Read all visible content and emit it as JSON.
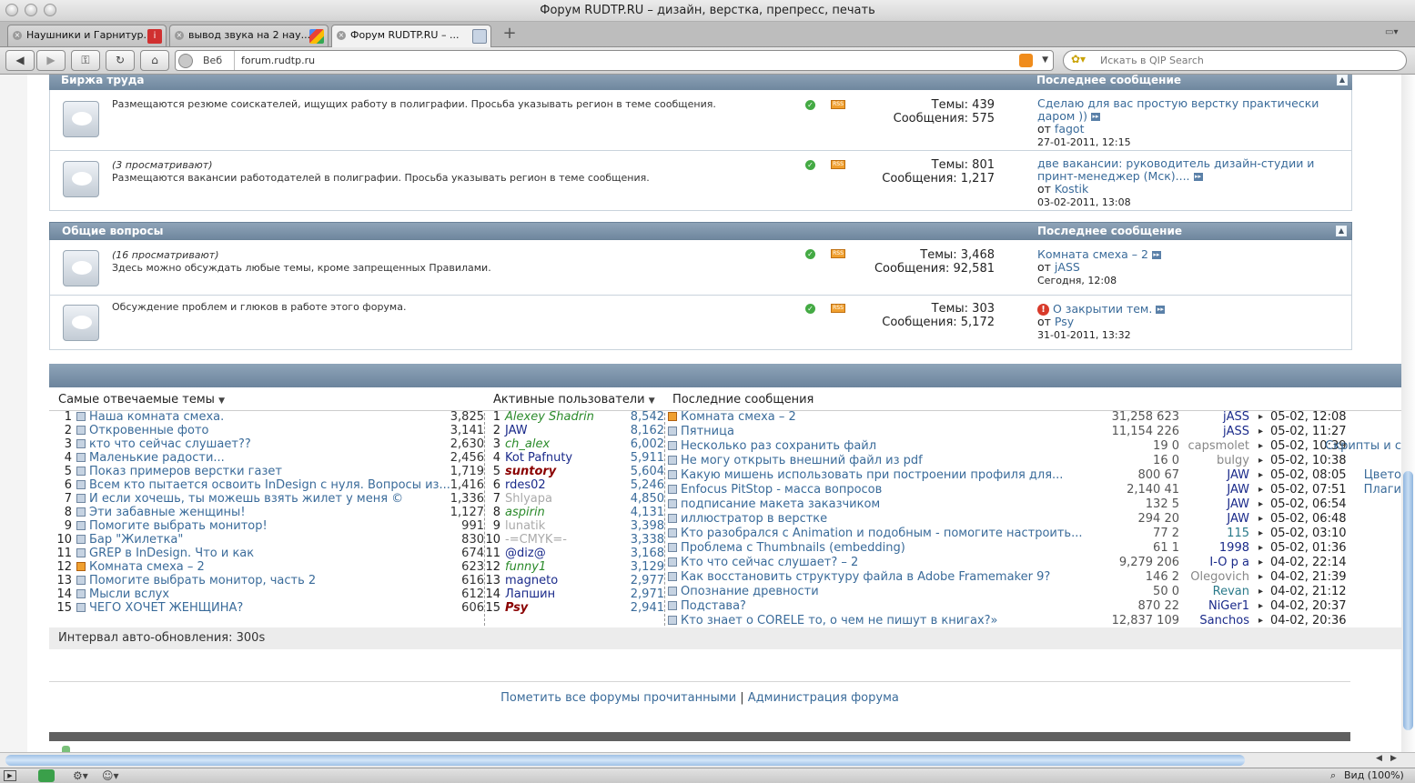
{
  "window": {
    "title": "Форум RUDTP.RU – дизайн, верстка, препресс, печать"
  },
  "tabs": [
    {
      "label": "Наушники и Гарнитур..."
    },
    {
      "label": "вывод звука на 2 нау..."
    },
    {
      "label": "Форум RUDTP.RU – ..."
    }
  ],
  "toolbar": {
    "web_label": "Веб",
    "url": "forum.rudtp.ru",
    "search_placeholder": "Искать в QIP Search"
  },
  "sections": [
    {
      "title": "Биржа труда",
      "last_label": "Последнее сообщение",
      "forums": [
        {
          "viewers": "",
          "desc": "Размещаются резюме соискателей, ищущих работу в полиграфии. Просьба указывать регион в теме сообщения.",
          "topics": "Темы: 439",
          "posts": "Сообщения: 575",
          "last_title": "Сделаю для вас простую верстку практически даром ))",
          "last_by_prefix": "от",
          "last_by": "fagot",
          "last_date": "27-01-2011, 12:15"
        },
        {
          "viewers": "(3 просматривают)",
          "desc": "Размещаются вакансии работодателей в полиграфии. Просьба указывать регион в теме сообщения.",
          "topics": "Темы: 801",
          "posts": "Сообщения: 1,217",
          "last_title": "две вакансии: руководитель дизайн-студии и принт-менеджер (Мск)....",
          "last_by_prefix": "от",
          "last_by": "Kostik",
          "last_date": "03-02-2011, 13:08"
        }
      ]
    },
    {
      "title": "Общие вопросы",
      "last_label": "Последнее сообщение",
      "forums": [
        {
          "viewers": "(16 просматривают)",
          "desc": "Здесь можно обсуждать любые темы, кроме запрещенных Правилами.",
          "topics": "Темы: 3,468",
          "posts": "Сообщения: 92,581",
          "last_title": "Комната смеха – 2",
          "last_by_prefix": "от",
          "last_by": "jASS",
          "last_date": "Сегодня, 12:08"
        },
        {
          "viewers": "",
          "desc": "Обсуждение проблем и глюков в работе этого форума.",
          "topics": "Темы: 303",
          "posts": "Сообщения: 5,172",
          "last_title": "О закрытии тем.",
          "last_by_prefix": "от",
          "last_by": "Psy",
          "last_date": "31-01-2011, 13:32"
        }
      ]
    }
  ],
  "stats": {
    "top_topics_label": "Самые отвечаемые темы",
    "active_users_label": "Активные пользователи",
    "recent_label": "Последние сообщения",
    "top_topics": [
      {
        "n": "1",
        "title": "Наша комната смеха.",
        "count": "3,825"
      },
      {
        "n": "2",
        "title": "Откровенные фото",
        "count": "3,141"
      },
      {
        "n": "3",
        "title": "кто что сейчас слушает??",
        "count": "2,630"
      },
      {
        "n": "4",
        "title": "Маленькие радости...",
        "count": "2,456"
      },
      {
        "n": "5",
        "title": "Показ примеров верстки газет",
        "count": "1,719"
      },
      {
        "n": "6",
        "title": "Всем кто пытается освоить InDesign с нуля. Вопросы из...",
        "count": "1,416"
      },
      {
        "n": "7",
        "title": "И если хочешь, ты можешь взять жилет у меня ©",
        "count": "1,336"
      },
      {
        "n": "8",
        "title": "Эти забавные женщины!",
        "count": "1,127"
      },
      {
        "n": "9",
        "title": "Помогите выбрать монитор!",
        "count": "991"
      },
      {
        "n": "10",
        "title": "Бар \"Жилетка\"",
        "count": "830"
      },
      {
        "n": "11",
        "title": "GREP в InDesign. Что и как",
        "count": "674"
      },
      {
        "n": "12",
        "title": "Комната смеха – 2",
        "count": "623"
      },
      {
        "n": "13",
        "title": "Помогите выбрать монитор, часть 2",
        "count": "616"
      },
      {
        "n": "14",
        "title": "Мысли вслух",
        "count": "612"
      },
      {
        "n": "15",
        "title": "ЧЕГО ХОЧЕТ ЖЕНЩИНА?",
        "count": "606"
      }
    ],
    "users": [
      {
        "n": "1",
        "name": "Alexey Shadrin",
        "count": "8,542",
        "color": "#2a8a2a",
        "style": "italic"
      },
      {
        "n": "2",
        "name": "JAW",
        "count": "8,162",
        "color": "#1a2a8a",
        "style": "normal"
      },
      {
        "n": "3",
        "name": "ch_alex",
        "count": "6,002",
        "color": "#2a8a2a",
        "style": "italic"
      },
      {
        "n": "4",
        "name": "Kot Pafnuty",
        "count": "5,911",
        "color": "#1a2a8a",
        "style": "normal"
      },
      {
        "n": "5",
        "name": "suntory",
        "count": "5,604",
        "color": "#8a0000",
        "style": "bolditalic"
      },
      {
        "n": "6",
        "name": "rdes02",
        "count": "5,246",
        "color": "#1a2a8a",
        "style": "normal"
      },
      {
        "n": "7",
        "name": "Shlyapa",
        "count": "4,850",
        "color": "#aaaaaa",
        "style": "normal"
      },
      {
        "n": "8",
        "name": "aspirin",
        "count": "4,131",
        "color": "#2a8a2a",
        "style": "italic"
      },
      {
        "n": "9",
        "name": "lunatik",
        "count": "3,398",
        "color": "#aaaaaa",
        "style": "normal"
      },
      {
        "n": "10",
        "name": "-=CMYK=-",
        "count": "3,338",
        "color": "#aaaaaa",
        "style": "normal"
      },
      {
        "n": "11",
        "name": "@diz@",
        "count": "3,168",
        "color": "#1a2a8a",
        "style": "normal"
      },
      {
        "n": "12",
        "name": "funny1",
        "count": "3,129",
        "color": "#2a8a2a",
        "style": "italic"
      },
      {
        "n": "13",
        "name": "magneto",
        "count": "2,977",
        "color": "#1a2a8a",
        "style": "normal"
      },
      {
        "n": "14",
        "name": "Лапшин",
        "count": "2,971",
        "color": "#1a2a8a",
        "style": "normal"
      },
      {
        "n": "15",
        "name": "Psy",
        "count": "2,941",
        "color": "#8a0000",
        "style": "bolditalic"
      }
    ],
    "recent": [
      {
        "title": "Комната смеха – 2",
        "nums": "31,258 623",
        "user": "jASS",
        "ucolor": "#1a2a8a",
        "date": "05-02, 12:08",
        "forum": "",
        "hot": true
      },
      {
        "title": "Пятница",
        "nums": "11,154 226",
        "user": "jASS",
        "ucolor": "#1a2a8a",
        "date": "05-02, 11:27",
        "forum": ""
      },
      {
        "title": "Несколько раз сохранить файл",
        "nums": "19 0",
        "user": "capsmolet",
        "ucolor": "#888888",
        "date": "05-02, 10:39",
        "forum": "Скрипты и с"
      },
      {
        "title": "Не могу открыть внешний файл из pdf",
        "nums": "16 0",
        "user": "bulgy",
        "ucolor": "#888888",
        "date": "05-02, 10:38",
        "forum": ""
      },
      {
        "title": "Какую мишень использовать при построении профиля для...",
        "nums": "800 67",
        "user": "JAW",
        "ucolor": "#1a2a8a",
        "date": "05-02, 08:05",
        "forum": "Цвето"
      },
      {
        "title": "Enfocus PitStop - масса вопросов",
        "nums": "2,140 41",
        "user": "JAW",
        "ucolor": "#1a2a8a",
        "date": "05-02, 07:51",
        "forum": "Плаги"
      },
      {
        "title": "подписание макета заказчиком",
        "nums": "132 5",
        "user": "JAW",
        "ucolor": "#1a2a8a",
        "date": "05-02, 06:54",
        "forum": ""
      },
      {
        "title": "иллюстратор в верстке",
        "nums": "294 20",
        "user": "JAW",
        "ucolor": "#1a2a8a",
        "date": "05-02, 06:48",
        "forum": ""
      },
      {
        "title": "Кто разобрался с Animation и подобным - помогите настроить...",
        "nums": "77 2",
        "user": "115",
        "ucolor": "#2a7a8a",
        "date": "05-02, 03:10",
        "forum": ""
      },
      {
        "title": "Проблема с Thumbnails (embedding)",
        "nums": "61 1",
        "user": "1998",
        "ucolor": "#1a2a8a",
        "date": "05-02, 01:36",
        "forum": ""
      },
      {
        "title": "Кто что сейчас слушает? – 2",
        "nums": "9,279 206",
        "user": "I-O p a",
        "ucolor": "#1a2a8a",
        "date": "04-02, 22:14",
        "forum": ""
      },
      {
        "title": "Как восстановить структуру файла в Adobe Framemaker 9?",
        "nums": "146 2",
        "user": "Olegovich",
        "ucolor": "#888888",
        "date": "04-02, 21:39",
        "forum": ""
      },
      {
        "title": "Опознание древности",
        "nums": "50 0",
        "user": "Revan",
        "ucolor": "#2a7a8a",
        "date": "04-02, 21:12",
        "forum": ""
      },
      {
        "title": "Подстава?",
        "nums": "870 22",
        "user": "NiGer1",
        "ucolor": "#1a2a8a",
        "date": "04-02, 20:37",
        "forum": ""
      },
      {
        "title": "Кто знает о CORELE то, о чем не пишут в книгах?»",
        "nums": "12,837 109",
        "user": "Sanchos",
        "ucolor": "#1a2a8a",
        "date": "04-02, 20:36",
        "forum": ""
      }
    ],
    "interval": "Интервал авто-обновления: 300s"
  },
  "footer": {
    "mark_read": "Пометить все форумы прочитанными",
    "sep": "|",
    "admin": "Администрация форума"
  },
  "statusbar": {
    "zoom": "Вид (100%)"
  }
}
